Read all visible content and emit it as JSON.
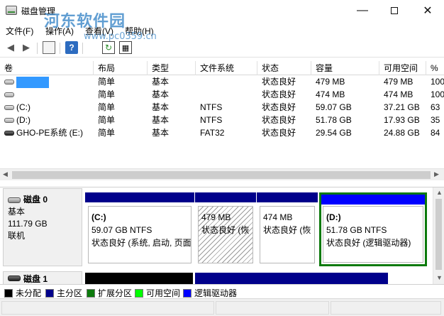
{
  "window": {
    "title": "磁盘管理",
    "watermark": "河东软件园",
    "watermark_url": "www.pc0359.cn",
    "minimize_glyph": "—",
    "close_glyph": "✕"
  },
  "menu": [
    "文件(F)",
    "操作(A)",
    "查看(V)",
    "帮助(H)"
  ],
  "toolbar": {
    "icons": [
      "back-arrow-icon",
      "forward-arrow-icon",
      "properties-icon",
      "help-icon",
      "refresh-icon",
      "rescan-disks-icon"
    ],
    "back_glyph": "◀",
    "forward_glyph": "▶",
    "help_glyph": "?",
    "refresh_glyph": "↻",
    "rescan_glyph": "▦"
  },
  "volume_table": {
    "columns": [
      "卷",
      "布局",
      "类型",
      "文件系统",
      "状态",
      "容量",
      "可用空间",
      "%"
    ],
    "rows": [
      {
        "volume": "",
        "layout": "简单",
        "type": "基本",
        "fs": "",
        "status": "状态良好",
        "capacity": "479 MB",
        "free": "479 MB",
        "pct": "100",
        "selected": true
      },
      {
        "volume": "",
        "layout": "简单",
        "type": "基本",
        "fs": "",
        "status": "状态良好",
        "capacity": "474 MB",
        "free": "474 MB",
        "pct": "100"
      },
      {
        "volume": "(C:)",
        "layout": "简单",
        "type": "基本",
        "fs": "NTFS",
        "status": "状态良好",
        "capacity": "59.07 GB",
        "free": "37.21 GB",
        "pct": "63"
      },
      {
        "volume": "(D:)",
        "layout": "简单",
        "type": "基本",
        "fs": "NTFS",
        "status": "状态良好",
        "capacity": "51.78 GB",
        "free": "17.93 GB",
        "pct": "35"
      },
      {
        "volume": "GHO-PE系统 (E:)",
        "layout": "简单",
        "type": "基本",
        "fs": "FAT32",
        "status": "状态良好",
        "capacity": "29.54 GB",
        "free": "24.88 GB",
        "pct": "84",
        "dark_icon": true
      }
    ]
  },
  "scroll": {
    "left": "◀",
    "right": "▶",
    "up": "▲",
    "down": "▼"
  },
  "disk0": {
    "name": "磁盘 0",
    "type": "基本",
    "size": "111.79 GB",
    "status": "联机",
    "partitions": [
      {
        "name": "(C:)",
        "size": "59.07 GB NTFS",
        "status": "状态良好 (系统, 启动, 页面"
      },
      {
        "name": "",
        "size": "479 MB",
        "status": "状态良好 (恢"
      },
      {
        "name": "",
        "size": "474 MB",
        "status": "状态良好 (恢"
      },
      {
        "name": "(D:)",
        "size": "51.78 GB NTFS",
        "status": "状态良好 (逻辑驱动器)"
      }
    ]
  },
  "disk1": {
    "name": "磁盘 1"
  },
  "legend": [
    {
      "label": "未分配",
      "color": "#000000"
    },
    {
      "label": "主分区",
      "color": "#00008b"
    },
    {
      "label": "扩展分区",
      "color": "#0c7a0c"
    },
    {
      "label": "可用空间",
      "color": "#00ff00"
    },
    {
      "label": "逻辑驱动器",
      "color": "#0000ff"
    }
  ]
}
